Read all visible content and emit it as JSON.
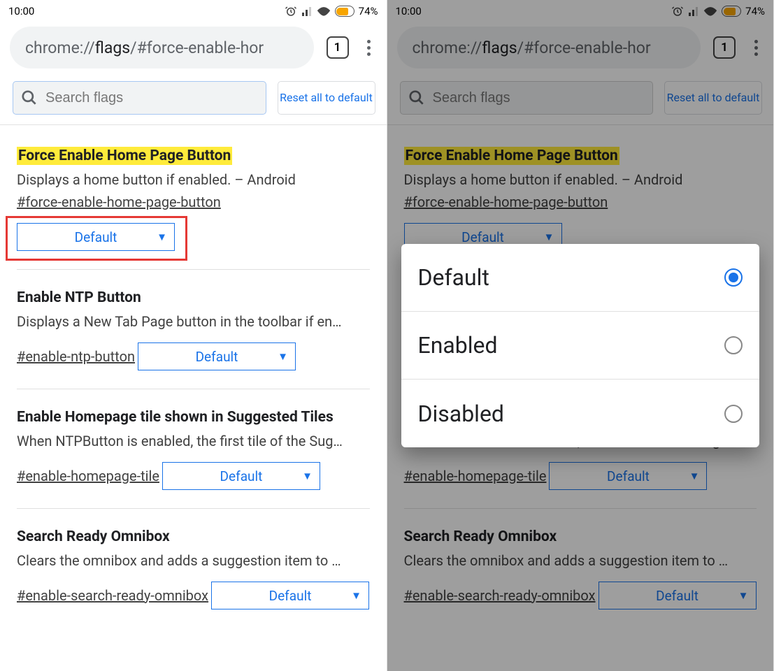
{
  "status": {
    "time": "10:00",
    "battery": "74%"
  },
  "nav": {
    "url_gray1": "chrome://",
    "url_dark": "flags",
    "url_gray2": "/#force-enable-hor",
    "tab_count": "1"
  },
  "controls": {
    "search_placeholder": "Search flags",
    "reset_label": "Reset all to default"
  },
  "flags": [
    {
      "title": "Force Enable Home Page Button",
      "highlighted": true,
      "desc": "Displays a home button if enabled. – Android",
      "anchor": "#force-enable-home-page-button",
      "value": "Default",
      "red_box": true
    },
    {
      "title": "Enable NTP Button",
      "desc": "Displays a New Tab Page button in the toolbar if en…",
      "anchor": "#enable-ntp-button",
      "value": "Default"
    },
    {
      "title": "Enable Homepage tile shown in Suggested Tiles",
      "desc": "When NTPButton is enabled, the first tile of the Sug…",
      "anchor": "#enable-homepage-tile",
      "value": "Default"
    },
    {
      "title": "Search Ready Omnibox",
      "desc": "Clears the omnibox and adds a suggestion item to …",
      "anchor": "#enable-search-ready-omnibox",
      "value": "Default"
    }
  ],
  "popup": {
    "options": [
      "Default",
      "Enabled",
      "Disabled"
    ],
    "selected_index": 0
  }
}
